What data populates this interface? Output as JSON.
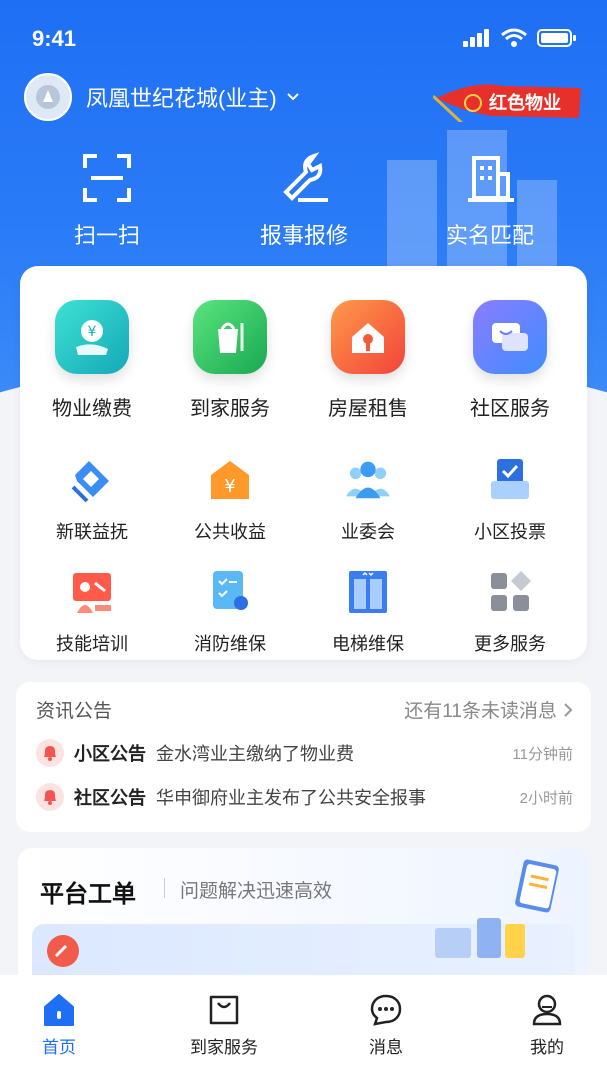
{
  "status": {
    "time": "9:41"
  },
  "header": {
    "community": "凤凰世纪花城(业主)",
    "badge_label": "红色物业"
  },
  "quick_actions": [
    {
      "label": "扫一扫",
      "icon": "scan-icon"
    },
    {
      "label": "报事报修",
      "icon": "wrench-icon"
    },
    {
      "label": "实名匹配",
      "icon": "building-icon"
    }
  ],
  "services_primary": [
    {
      "label": "物业缴费",
      "icon": "property-fee-icon",
      "color": "#1fc7c0"
    },
    {
      "label": "到家服务",
      "icon": "home-service-icon",
      "color": "#2fc46a"
    },
    {
      "label": "房屋租售",
      "icon": "house-rent-icon",
      "color": "#ff6a3d"
    },
    {
      "label": "社区服务",
      "icon": "community-service-icon",
      "color": "#6a7cff"
    }
  ],
  "services_secondary": [
    {
      "label": "新联益抚",
      "icon": "heart-hand-icon"
    },
    {
      "label": "公共收益",
      "icon": "public-income-icon"
    },
    {
      "label": "业委会",
      "icon": "committee-icon"
    },
    {
      "label": "小区投票",
      "icon": "vote-icon"
    },
    {
      "label": "技能培训",
      "icon": "training-icon"
    },
    {
      "label": "消防维保",
      "icon": "fire-maintenance-icon"
    },
    {
      "label": "电梯维保",
      "icon": "elevator-icon"
    },
    {
      "label": "更多服务",
      "icon": "more-services-icon"
    }
  ],
  "news": {
    "title": "资讯公告",
    "more": "还有11条未读消息",
    "items": [
      {
        "tag": "小区公告",
        "text": "金水湾业主缴纳了物业费",
        "ago": "11分钟前"
      },
      {
        "tag": "社区公告",
        "text": "华申御府业主发布了公共安全报事",
        "ago": "2小时前"
      }
    ]
  },
  "platform": {
    "title": "平台工单",
    "subtitle": "问题解决迅速高效"
  },
  "tabs": [
    {
      "label": "首页",
      "icon": "home-icon",
      "active": true
    },
    {
      "label": "到家服务",
      "icon": "bag-icon",
      "active": false
    },
    {
      "label": "消息",
      "icon": "chat-icon",
      "active": false
    },
    {
      "label": "我的",
      "icon": "person-icon",
      "active": false
    }
  ]
}
